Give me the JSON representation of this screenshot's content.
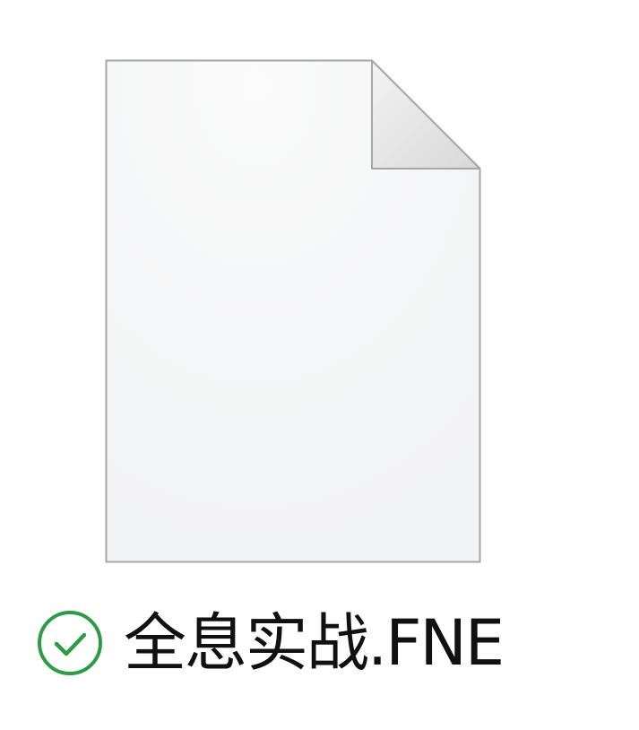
{
  "file": {
    "name": "全息实战.FNE",
    "icon": "blank-document-icon",
    "sync_status_icon": "synced-checkmark-icon",
    "colors": {
      "sync_status": "#2e9b47",
      "page": "#f7f8f9",
      "page_border": "#a6a6a6",
      "fold": "#e3e3e3"
    }
  }
}
